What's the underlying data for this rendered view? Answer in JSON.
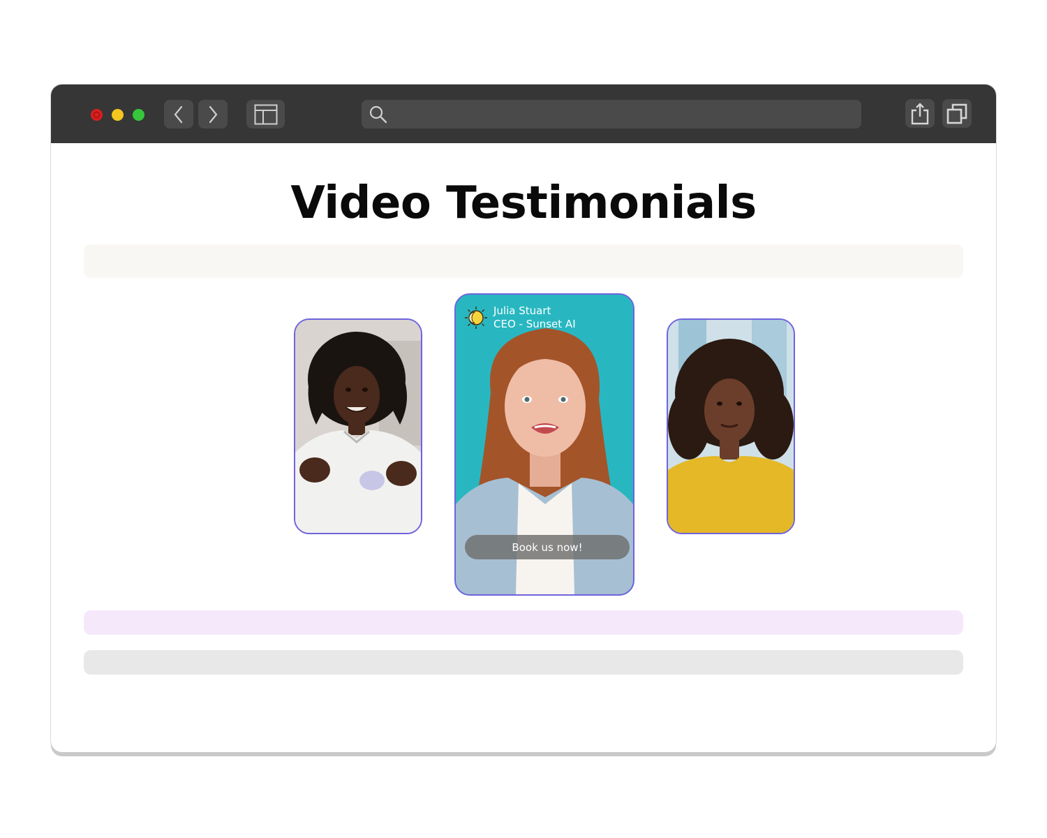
{
  "page": {
    "title": "Video Testimonials"
  },
  "browser": {
    "address_value": ""
  },
  "testimonials": [
    {
      "position": "left"
    },
    {
      "position": "center",
      "name": "Julia Stuart",
      "role": "CEO - Sunset AI",
      "cta_label": "Book us now!"
    },
    {
      "position": "right"
    }
  ],
  "colors": {
    "toolbar_bg": "#363636",
    "card_border": "#6f63dd",
    "center_bg": "#28b7c1",
    "bar_top": "#f8f7f3",
    "bar_pink": "#f6e8fb",
    "bar_grey": "#e8e8e8"
  },
  "icons": {
    "back": "chevron-left-icon",
    "forward": "chevron-right-icon",
    "sidebar": "sidebar-icon",
    "search": "search-icon",
    "share": "share-icon",
    "tabs": "tabs-icon",
    "logo": "sun-logo-icon"
  }
}
